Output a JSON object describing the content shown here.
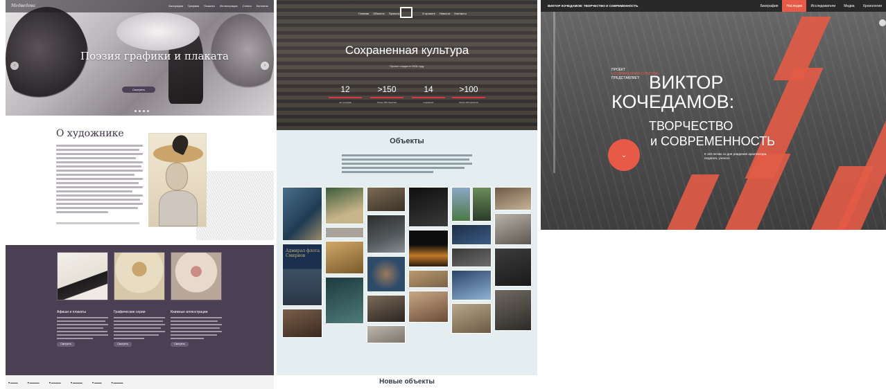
{
  "panel1": {
    "logo": "Медведева",
    "nav": [
      "Биография",
      "Графика",
      "Плакаты",
      "Иллюстрации",
      "Статьи",
      "Контакты"
    ],
    "hero_subtitle": "",
    "hero_title": "Поэзия графики и плаката",
    "hero_tagline": "",
    "hero_button": "Смотреть",
    "about_title": "О художнике",
    "cards": [
      {
        "title": "Афиши и плакаты",
        "button": "Смотреть"
      },
      {
        "title": "Графические серии",
        "button": "Смотреть"
      },
      {
        "title": "Книжные иллюстрации",
        "button": "Смотреть"
      }
    ],
    "colors": {
      "accent": "#4d4157",
      "section_bg": "#4b3f54"
    }
  },
  "panel2": {
    "nav_left": [
      "Главная",
      "Объекты",
      "Проекты"
    ],
    "nav_right": [
      "О проекте",
      "Новости",
      "Контакты"
    ],
    "hero_title": "Сохраненная культура",
    "hero_subtitle": "Проект создан в 2006 году",
    "stats": [
      {
        "num": "12",
        "label": "лет на рынке"
      },
      {
        "num": ">150",
        "label": "более 150 объектов"
      },
      {
        "num": "14",
        "label": "сохранено"
      },
      {
        "num": ">100",
        "label": "более 100 проектов"
      }
    ],
    "objects_title": "Объекты",
    "book_title": "Адмирал флота Смирнов",
    "new_objects_title": "Новые объекты",
    "colors": {
      "accent": "#d9363e",
      "objects_bg": "#e4eef1"
    }
  },
  "panel3": {
    "brand": "ВИКТОР КОЧЕДАМОВ: ТВОРЧЕСТВО И СОВРЕМЕННОСТЬ",
    "nav": [
      {
        "label": "Биография",
        "active": false
      },
      {
        "label": "Наследие",
        "active": true
      },
      {
        "label": "Исследователи",
        "active": false
      },
      {
        "label": "Медиа",
        "active": false
      },
      {
        "label": "Хронология",
        "active": false
      }
    ],
    "project_line1": "ПРОЕКТ",
    "project_line2": "«СОХРАНЕННАЯ КУЛЬТУРА»",
    "project_line3": "ПРЕДСТАВЛЯЕТ:",
    "title1": "ВИКТОР",
    "title2": "КОЧЕДАМОВ:",
    "title3": "ТВОРЧЕСТВО",
    "title4": "и СОВРЕМЕННОСТЬ",
    "desc_line1": "К 110-летию со дня рождения архитектора,",
    "desc_line2": "педагога, ученого",
    "circle_icon": "⌄",
    "colors": {
      "accent": "#e85a48",
      "topbar": "#292929"
    }
  }
}
